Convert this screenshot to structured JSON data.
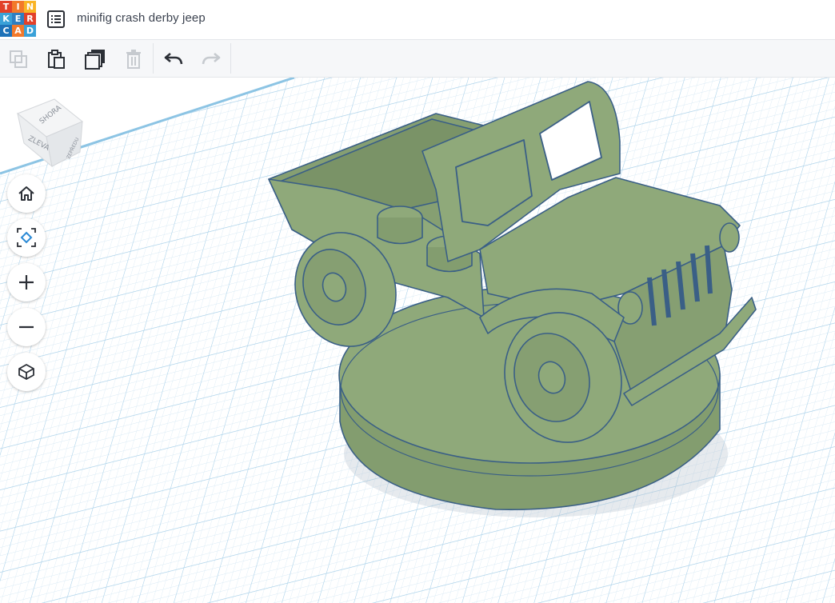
{
  "app": {
    "logo_letters": [
      "T",
      "I",
      "N",
      "K",
      "E",
      "R",
      "C",
      "A",
      "D"
    ],
    "logo_colors": [
      "#e2412a",
      "#f2792b",
      "#f9b426",
      "#3aa1d8",
      "#2f7ec1",
      "#e2412a",
      "#1e72b8",
      "#f2792b",
      "#3aa1d8"
    ],
    "title": "minifig crash derby jeep"
  },
  "toolbar": {
    "buttons": [
      {
        "name": "copy",
        "icon": "copy-icon",
        "enabled": false
      },
      {
        "name": "paste",
        "icon": "paste-icon",
        "enabled": true
      },
      {
        "name": "duplicate",
        "icon": "duplicate-icon",
        "enabled": true
      },
      {
        "name": "delete",
        "icon": "trash-icon",
        "enabled": false
      },
      {
        "name": "undo",
        "icon": "undo-icon",
        "enabled": true
      },
      {
        "name": "redo",
        "icon": "redo-icon",
        "enabled": false
      }
    ]
  },
  "view_cube": {
    "top_label": "SHORA",
    "left_label": "ZLEVA",
    "right_label": "ZEPŘEDU"
  },
  "view_controls": [
    {
      "name": "home-view",
      "icon": "home-icon"
    },
    {
      "name": "fit-view",
      "icon": "fit-view-icon"
    },
    {
      "name": "zoom-in",
      "icon": "plus-icon"
    },
    {
      "name": "zoom-out",
      "icon": "minus-icon"
    },
    {
      "name": "perspective",
      "icon": "cube-perspective-icon"
    }
  ],
  "colors": {
    "model_fill": "#8fa97a",
    "model_outline": "#3a5f86",
    "grid_line": "#cfe4f2",
    "grid_major": "#a8d0ea"
  }
}
